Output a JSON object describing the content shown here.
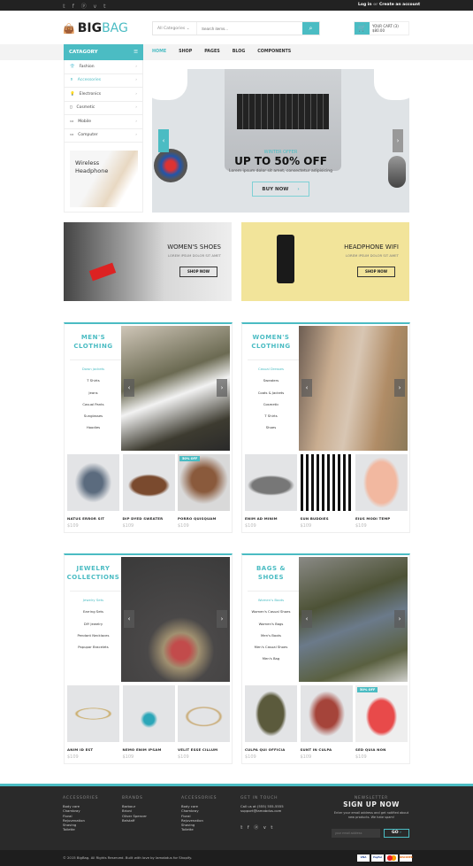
{
  "topbar": {
    "social": [
      "twitter-icon",
      "facebook-icon",
      "pinterest-icon",
      "vimeo-icon",
      "tumblr-icon"
    ],
    "social_glyphs": "𝕥 f ⓟ v t",
    "login": "Log in",
    "or": "or",
    "create": "Create an account"
  },
  "header": {
    "logo_bold": "BIG",
    "logo_light": "BAG",
    "search_category": "All Categories",
    "search_placeholder": "Search items...",
    "cart_label": "YOUR CART (3)",
    "cart_total": "$80.00"
  },
  "nav": {
    "category_label": "CATAGORY",
    "items": [
      "HOME",
      "SHOP",
      "PAGES",
      "BLOG",
      "COMPONENTS"
    ]
  },
  "sidebar": {
    "items": [
      {
        "label": "Fashion",
        "icon": "shirt-icon",
        "g": "👕"
      },
      {
        "label": "Accessories",
        "icon": "bottle-icon",
        "g": "⚱"
      },
      {
        "label": "Electronics",
        "icon": "bulb-icon",
        "g": "💡"
      },
      {
        "label": "Cosmetic",
        "icon": "lipstick-icon",
        "g": "▯"
      },
      {
        "label": "Mobile",
        "icon": "mobile-icon",
        "g": "▭"
      },
      {
        "label": "Computer",
        "icon": "computer-icon",
        "g": "▭"
      }
    ],
    "promo": "Wireless Headphone"
  },
  "hero": {
    "offer": "WINTER OFFER",
    "headline": "UP TO 50% OFF",
    "sub": "Lorem ipsum dolor sit amet, consectetur adipisicing",
    "button": "BUY NOW"
  },
  "banners": [
    {
      "title": "WOMEN'S SHOES",
      "sub": "LOREM IPSUM DOLOR SIT AMET",
      "button": "SHOP NOW"
    },
    {
      "title": "HEADPHONE WIFI",
      "sub": "LOREM IPSUM DOLOR SIT AMET",
      "button": "SHOP NOW"
    }
  ],
  "sections": [
    {
      "title": "MEN'S CLOTHING",
      "links": [
        "Down jackets",
        "T Shirts",
        "Jeans",
        "Casual Pants",
        "Sunglasses",
        "Hoodies"
      ],
      "img": "linear-gradient(160deg,#cfc6b8 0%,#6b6a52 40%,#f2f2f2 55%,#3d3b30 80%,#2a2a2a 100%)",
      "products": [
        {
          "name": "NATUS ERROR SIT",
          "price": "$109",
          "bg": "radial-gradient(#5b6b7e 25%,#e3e4e6 50%)"
        },
        {
          "name": "DIP DYED SWEATER",
          "price": "$109",
          "bg": "radial-gradient(ellipse 40% 20% at 50% 55%,#7a4a2e 80%,#e3e4e6 100%)"
        },
        {
          "name": "PORRO QUISQUAM",
          "price": "$109",
          "badge": "50% OFF",
          "bg": "radial-gradient(circle at 50% 45%,#8a5a3c 30%,#d9d9d9 60%)"
        }
      ]
    },
    {
      "title": "WOMEN'S CLOTHING",
      "links": [
        "Casual Dresses",
        "Sweaters",
        "Coats & Jackets",
        "Cosmetic",
        "T Shirts",
        "Shoes"
      ],
      "img": "linear-gradient(100deg,#6d5d52 0%,#c9ad90 30%,#d8c6b3 50%,#b08c66 75%,#8c7a5a 100%)",
      "products": [
        {
          "name": "ENIM AD MINIM",
          "price": "$109",
          "bg": "radial-gradient(ellipse 45% 18% at 50% 55%,#777 80%,#e3e4e6 100%)"
        },
        {
          "name": "SUN BUDDIES",
          "price": "$109",
          "bg": "repeating-linear-gradient(90deg,#111 0 3px,#fff 3px 6px)"
        },
        {
          "name": "EIUS MODI TEMP",
          "price": "$109",
          "bg": "radial-gradient(ellipse 35% 45% at 50% 50%,#f2b8a0 80%,#e3e4e6 100%)"
        }
      ]
    },
    {
      "title": "JEWELRY COLLECTIONS",
      "links": [
        "Jewelry Sets",
        "Earring Sets",
        "DIY Jewelry",
        "Pendant Necklaces",
        "Popupar Bracelets"
      ],
      "img": "radial-gradient(circle at 55% 75%,#c24b4b 8%,#a09070 16%,#4a4848 30%,#3a3a3a 100%)",
      "products": [
        {
          "name": "ANIM ID EST",
          "price": "$109",
          "bg": "radial-gradient(ellipse 40% 12% at 50% 50%,#e3e4e6 70%,#c8a860 80%,#e3e4e6 90%)"
        },
        {
          "name": "NEMO ENIM IPSAM",
          "price": "$109",
          "bg": "radial-gradient(circle at 50% 60%,#2ba6b8 12%,#e3e4e6 20%)"
        },
        {
          "name": "VELIT ESSE CILLUM",
          "price": "$109",
          "bg": "radial-gradient(ellipse 40% 20% at 50% 55%,#e3e4e6 70%,#c8a870 80%,#e3e4e6 90%)"
        }
      ]
    },
    {
      "title": "BAGS & SHOES",
      "links": [
        "Women's Boots",
        "Women's Casual Shoes",
        "Women's Bags",
        "Men's Boots",
        "Men's Casual Shoes",
        "Men's Bag"
      ],
      "img": "linear-gradient(160deg,#8a8a86 0%,#4d5236 35%,#6b7a8a 55%,#5a6040 80%,#d0d0cc 100%)",
      "products": [
        {
          "name": "CULPA QUI OFFICIA",
          "price": "$109",
          "bg": "radial-gradient(ellipse 30% 40% at 50% 50%,#5b5a3c 80%,#e3e4e6 100%)"
        },
        {
          "name": "SUNT IN CULPA",
          "price": "$109",
          "bg": "radial-gradient(ellipse 35% 40% at 50% 50%,#a5443a 60%,#e3e4e6 100%)"
        },
        {
          "name": "SED QUIA NON",
          "price": "$109",
          "badge": "50% OFF",
          "bg": "radial-gradient(ellipse 30% 35% at 50% 55%,#e84a4a 80%,#eee 100%)"
        }
      ]
    }
  ],
  "footer": {
    "columns": [
      {
        "title": "ACCESSORIES",
        "items": [
          "Body care",
          "Chambray",
          "Floral",
          "Rejuvenation",
          "Shaving",
          "Toilette"
        ]
      },
      {
        "title": "BRANDS",
        "items": [
          "Barbour",
          "Brioni",
          "Oliver Spencer",
          "Belstaff"
        ]
      },
      {
        "title": "ACCESSORIES",
        "items": [
          "Body care",
          "Chambray",
          "Floral",
          "Rejuvenation",
          "Shaving",
          "Toilette"
        ]
      },
      {
        "title": "GET IN TOUCH",
        "items": [
          "Call us at (555) 555-5555",
          "support@iamabdus.com"
        ]
      }
    ],
    "newsletter_heading": "NEWSLETTER",
    "newsletter_title": "SIGN UP NOW",
    "newsletter_desc": "Enter your email address and get notified about new products. We hate spam!",
    "email_placeholder": "your email address",
    "go": "GO",
    "copyright": "© 2015 BigBag. All Rights Reserved. Built with love by Iamabdus for Shopify.",
    "payments": [
      "VISA",
      "PayPal",
      "MC",
      "DISCOVER"
    ]
  },
  "colors": {
    "accent": "#4bbcc3",
    "dark": "#2a2a2a"
  }
}
